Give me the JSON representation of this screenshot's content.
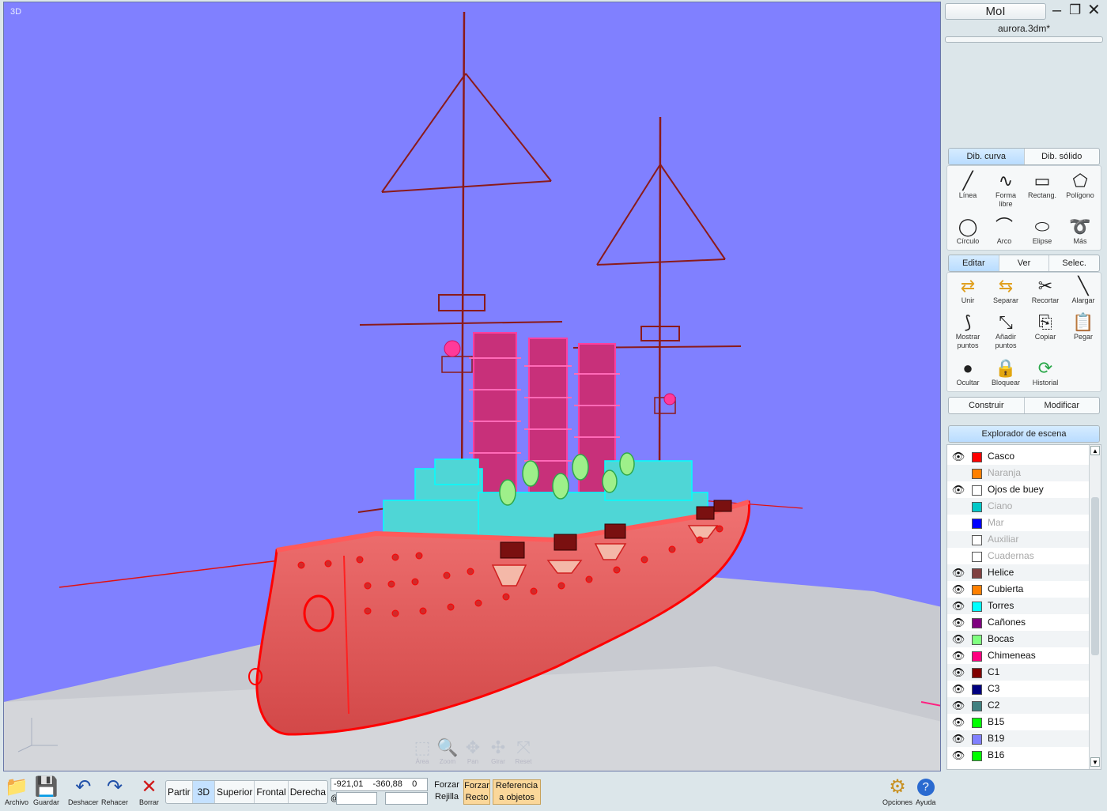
{
  "viewport": {
    "label": "3D"
  },
  "nav_controls": [
    {
      "label": "Área",
      "icon": "area-zoom-icon",
      "glyph": "⬚"
    },
    {
      "label": "Zoom",
      "icon": "zoom-icon",
      "glyph": "🔍"
    },
    {
      "label": "Pan",
      "icon": "pan-icon",
      "glyph": "✥"
    },
    {
      "label": "Girar",
      "icon": "rotate-icon",
      "glyph": "✣"
    },
    {
      "label": "Reset",
      "icon": "reset-icon",
      "glyph": "⤧"
    }
  ],
  "app": {
    "name": "MoI",
    "filename": "aurora.3dm*"
  },
  "draw_tabs": [
    {
      "label": "Dib. curva",
      "active": true
    },
    {
      "label": "Dib. sólido",
      "active": false
    }
  ],
  "draw_tools": [
    {
      "label": "Línea",
      "icon": "line-icon",
      "glyph": "╱"
    },
    {
      "label": "Forma libre",
      "icon": "freeform-icon",
      "glyph": "∿"
    },
    {
      "label": "Rectang.",
      "icon": "rectangle-icon",
      "glyph": "▭"
    },
    {
      "label": "Polígono",
      "icon": "polygon-icon",
      "glyph": "⬠"
    },
    {
      "label": "Círculo",
      "icon": "circle-icon",
      "glyph": "◯"
    },
    {
      "label": "Arco",
      "icon": "arc-icon",
      "glyph": "⌒"
    },
    {
      "label": "Elipse",
      "icon": "ellipse-icon",
      "glyph": "⬭"
    },
    {
      "label": "Más",
      "icon": "more-icon",
      "glyph": "➰"
    }
  ],
  "edit_tabs": [
    {
      "label": "Editar",
      "active": true
    },
    {
      "label": "Ver",
      "active": false
    },
    {
      "label": "Selec.",
      "active": false
    }
  ],
  "edit_tools": [
    {
      "label": "Unir",
      "icon": "join-icon",
      "glyph": "⇄"
    },
    {
      "label": "Separar",
      "icon": "separate-icon",
      "glyph": "⇆"
    },
    {
      "label": "Recortar",
      "icon": "trim-icon",
      "glyph": "✂"
    },
    {
      "label": "Alargar",
      "icon": "extend-icon",
      "glyph": "╲"
    },
    {
      "label": "Mostrar puntos",
      "icon": "show-points-icon",
      "glyph": "⟆"
    },
    {
      "label": "Añadir puntos",
      "icon": "add-points-icon",
      "glyph": "⤡"
    },
    {
      "label": "Copiar",
      "icon": "copy-icon",
      "glyph": "⎘"
    },
    {
      "label": "Pegar",
      "icon": "paste-icon",
      "glyph": "📋"
    },
    {
      "label": "Ocultar",
      "icon": "hide-icon",
      "glyph": "●"
    },
    {
      "label": "Bloquear",
      "icon": "lock-icon",
      "glyph": "🔒"
    },
    {
      "label": "Historial",
      "icon": "history-icon",
      "glyph": "⟳"
    }
  ],
  "construct_tabs": [
    {
      "label": "Construir"
    },
    {
      "label": "Modificar"
    }
  ],
  "scene_explorer": {
    "title": "Explorador de escena",
    "layers": [
      {
        "name": "Casco",
        "color": "#ff0000",
        "visible": true,
        "selected": true
      },
      {
        "name": "Naranja",
        "color": "#ff8000",
        "visible": false
      },
      {
        "name": "Ojos de buey",
        "color": "#ffffff",
        "visible": true
      },
      {
        "name": "Ciano",
        "color": "#00c8c8",
        "visible": false
      },
      {
        "name": "Mar",
        "color": "#0000ff",
        "visible": false
      },
      {
        "name": "Auxiliar",
        "color": "#ffffff",
        "visible": false
      },
      {
        "name": "Cuadernas",
        "color": "#ffffff",
        "visible": false
      },
      {
        "name": "Helice",
        "color": "#804040",
        "visible": true
      },
      {
        "name": "Cubierta",
        "color": "#ff8000",
        "visible": true
      },
      {
        "name": "Torres",
        "color": "#00ffff",
        "visible": true
      },
      {
        "name": "Cañones",
        "color": "#800080",
        "visible": true
      },
      {
        "name": "Bocas",
        "color": "#80ff80",
        "visible": true
      },
      {
        "name": "Chimeneas",
        "color": "#ff0080",
        "visible": true
      },
      {
        "name": "C1",
        "color": "#800000",
        "visible": true
      },
      {
        "name": "C3",
        "color": "#000080",
        "visible": true
      },
      {
        "name": "C2",
        "color": "#408080",
        "visible": true
      },
      {
        "name": "B15",
        "color": "#00ff00",
        "visible": true
      },
      {
        "name": "B19",
        "color": "#8080ff",
        "visible": true
      },
      {
        "name": "B16",
        "color": "#00ff00",
        "visible": true
      }
    ]
  },
  "bottom": {
    "file_buttons": [
      {
        "label": "Archivo",
        "icon": "folder-icon",
        "glyph": "📁"
      },
      {
        "label": "Guardar",
        "icon": "save-icon",
        "glyph": "💾"
      },
      {
        "label": "Deshacer",
        "icon": "undo-icon",
        "glyph": "↶"
      },
      {
        "label": "Rehacer",
        "icon": "redo-icon",
        "glyph": "↷"
      },
      {
        "label": "Borrar",
        "icon": "delete-icon",
        "glyph": "✕"
      }
    ],
    "views": [
      {
        "label": "Partir",
        "active": false
      },
      {
        "label": "3D",
        "active": true
      },
      {
        "label": "Superior",
        "active": false
      },
      {
        "label": "Frontal",
        "active": false
      },
      {
        "label": "Derecha",
        "active": false
      }
    ],
    "coords": {
      "x": "-921,01",
      "y": "-360,88",
      "z": "0",
      "prefix": "@",
      "extra": ""
    },
    "snaps": [
      {
        "line1": "Forzar",
        "line2": "Rejilla",
        "on": false
      },
      {
        "line1": "Forzar",
        "line2": "Recto",
        "on": true
      },
      {
        "line1": "Referencia",
        "line2": "a objetos",
        "on": true
      }
    ],
    "right_buttons": [
      {
        "label": "Opciones",
        "icon": "options-icon",
        "glyph": "⚙"
      },
      {
        "label": "Ayuda",
        "icon": "help-icon",
        "glyph": "?"
      }
    ]
  },
  "colors": {
    "viewport_bg": "#8080ff",
    "hull": "#ff0000",
    "funnels": "#ff0080",
    "superstructure": "#00ffff",
    "masts": "#8b1a1a",
    "accent_tab": "#c4e1ff"
  }
}
